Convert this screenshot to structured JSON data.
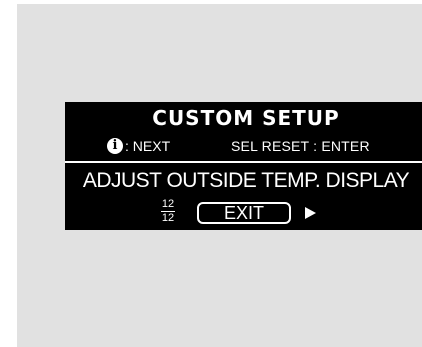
{
  "screen": {
    "title": "CUSTOM SETUP",
    "hints": {
      "info_icon": "i",
      "info_label": ": NEXT",
      "reset_label": "SEL RESET : ENTER"
    },
    "setting_label": "ADJUST OUTSIDE TEMP. DISPLAY",
    "page": {
      "current": "12",
      "total": "12"
    },
    "exit_label": "EXIT",
    "next_icon": "triangle-right-icon"
  },
  "colors": {
    "screen_background": "#000000",
    "screen_text": "#ffffff",
    "frame_background": "#e1e1e1"
  }
}
